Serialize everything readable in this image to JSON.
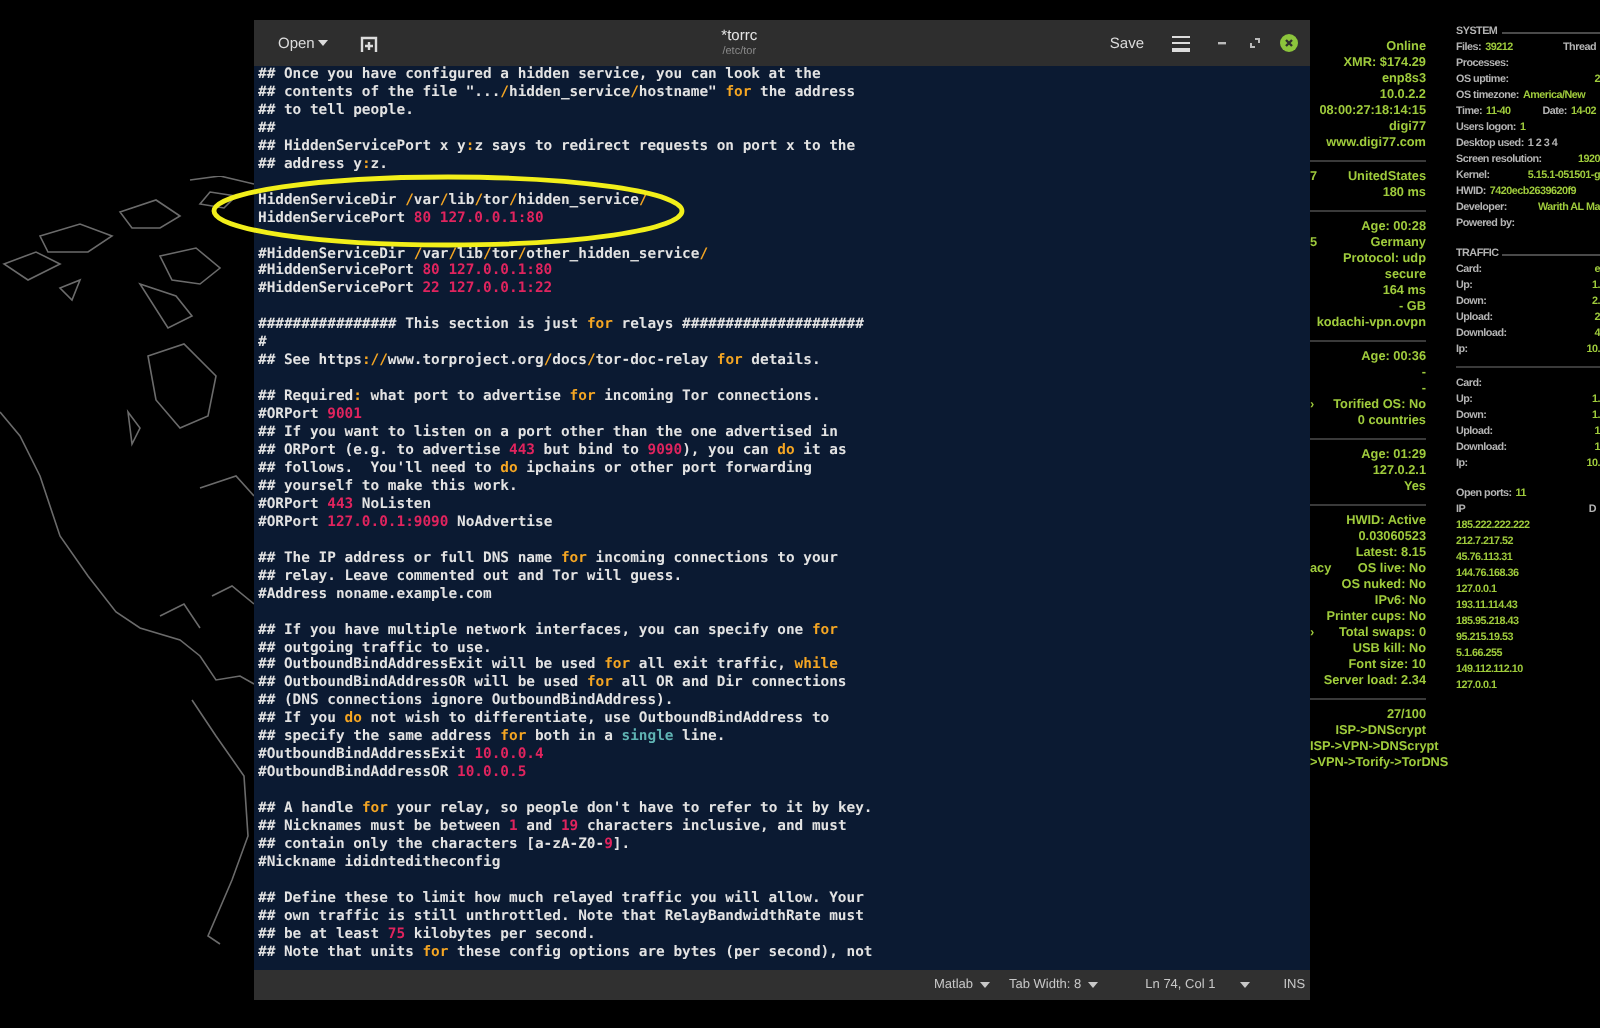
{
  "editor": {
    "open_button": "Open",
    "title": "*torrc",
    "subtitle": "/etc/tor",
    "save_button": "Save",
    "lines": [
      {
        "kind": "code",
        "segments": [
          {
            "kind": "plain",
            "text": "## Once you have configured a hidden service, you can look at the"
          }
        ]
      },
      {
        "kind": "code",
        "segments": [
          {
            "kind": "plain",
            "text": "## contents of the file \"..."
          },
          {
            "kind": "symbol",
            "text": "/"
          },
          {
            "kind": "plain",
            "text": "hidden_service"
          },
          {
            "kind": "symbol",
            "text": "/"
          },
          {
            "kind": "plain",
            "text": "hostname\" "
          },
          {
            "kind": "keyword",
            "text": "for"
          },
          {
            "kind": "plain",
            "text": " the address"
          }
        ]
      },
      {
        "kind": "code",
        "segments": [
          {
            "kind": "plain",
            "text": "## to tell people."
          }
        ]
      },
      {
        "kind": "code",
        "segments": [
          {
            "kind": "plain",
            "text": "##"
          }
        ]
      },
      {
        "kind": "code",
        "segments": [
          {
            "kind": "plain",
            "text": "## HiddenServicePort x y"
          },
          {
            "kind": "symbol",
            "text": ":"
          },
          {
            "kind": "plain",
            "text": "z says to redirect requests on port x to the"
          }
        ]
      },
      {
        "kind": "code",
        "segments": [
          {
            "kind": "plain",
            "text": "## address y"
          },
          {
            "kind": "symbol",
            "text": ":"
          },
          {
            "kind": "plain",
            "text": "z."
          }
        ]
      },
      {
        "kind": "blank"
      },
      {
        "kind": "code",
        "segments": [
          {
            "kind": "plain",
            "text": "HiddenServiceDir "
          },
          {
            "kind": "symbol",
            "text": "/"
          },
          {
            "kind": "plain",
            "text": "var"
          },
          {
            "kind": "symbol",
            "text": "/"
          },
          {
            "kind": "plain",
            "text": "lib"
          },
          {
            "kind": "symbol",
            "text": "/"
          },
          {
            "kind": "plain",
            "text": "tor"
          },
          {
            "kind": "symbol",
            "text": "/"
          },
          {
            "kind": "plain",
            "text": "hidden_service"
          },
          {
            "kind": "symbol",
            "text": "/"
          }
        ]
      },
      {
        "kind": "code",
        "segments": [
          {
            "kind": "plain",
            "text": "HiddenServicePort "
          },
          {
            "kind": "number",
            "text": "80 127.0.0.1:80"
          }
        ]
      },
      {
        "kind": "blank"
      },
      {
        "kind": "code",
        "segments": [
          {
            "kind": "plain",
            "text": "#HiddenServiceDir "
          },
          {
            "kind": "symbol",
            "text": "/"
          },
          {
            "kind": "plain",
            "text": "var"
          },
          {
            "kind": "symbol",
            "text": "/"
          },
          {
            "kind": "plain",
            "text": "lib"
          },
          {
            "kind": "symbol",
            "text": "/"
          },
          {
            "kind": "plain",
            "text": "tor"
          },
          {
            "kind": "symbol",
            "text": "/"
          },
          {
            "kind": "plain",
            "text": "other_hidden_service"
          },
          {
            "kind": "symbol",
            "text": "/"
          }
        ]
      },
      {
        "kind": "code",
        "segments": [
          {
            "kind": "plain",
            "text": "#HiddenServicePort "
          },
          {
            "kind": "number",
            "text": "80 127.0.0.1:80"
          }
        ]
      },
      {
        "kind": "code",
        "segments": [
          {
            "kind": "plain",
            "text": "#HiddenServicePort "
          },
          {
            "kind": "number",
            "text": "22 127.0.0.1:22"
          }
        ]
      },
      {
        "kind": "blank"
      },
      {
        "kind": "code",
        "segments": [
          {
            "kind": "plain",
            "text": "################ This section is just "
          },
          {
            "kind": "keyword",
            "text": "for"
          },
          {
            "kind": "plain",
            "text": " relays #####################"
          }
        ]
      },
      {
        "kind": "code",
        "segments": [
          {
            "kind": "plain",
            "text": "#"
          }
        ]
      },
      {
        "kind": "code",
        "segments": [
          {
            "kind": "plain",
            "text": "## See https"
          },
          {
            "kind": "symbol",
            "text": "://"
          },
          {
            "kind": "plain",
            "text": "www.torproject.org"
          },
          {
            "kind": "symbol",
            "text": "/"
          },
          {
            "kind": "plain",
            "text": "docs"
          },
          {
            "kind": "symbol",
            "text": "/"
          },
          {
            "kind": "plain",
            "text": "tor-doc-relay "
          },
          {
            "kind": "keyword",
            "text": "for"
          },
          {
            "kind": "plain",
            "text": " details."
          }
        ]
      },
      {
        "kind": "blank"
      },
      {
        "kind": "code",
        "segments": [
          {
            "kind": "plain",
            "text": "## Required"
          },
          {
            "kind": "symbol",
            "text": ":"
          },
          {
            "kind": "plain",
            "text": " what port to advertise "
          },
          {
            "kind": "keyword",
            "text": "for"
          },
          {
            "kind": "plain",
            "text": " incoming Tor connections."
          }
        ]
      },
      {
        "kind": "code",
        "segments": [
          {
            "kind": "plain",
            "text": "#ORPort "
          },
          {
            "kind": "number",
            "text": "9001"
          }
        ]
      },
      {
        "kind": "code",
        "segments": [
          {
            "kind": "plain",
            "text": "## If you want to listen on a port other than the one advertised in"
          }
        ]
      },
      {
        "kind": "code",
        "segments": [
          {
            "kind": "plain",
            "text": "## ORPort (e.g. to advertise "
          },
          {
            "kind": "number",
            "text": "443"
          },
          {
            "kind": "plain",
            "text": " but bind to "
          },
          {
            "kind": "number",
            "text": "9090"
          },
          {
            "kind": "plain",
            "text": "), you can "
          },
          {
            "kind": "keyword",
            "text": "do"
          },
          {
            "kind": "plain",
            "text": " it as"
          }
        ]
      },
      {
        "kind": "code",
        "segments": [
          {
            "kind": "plain",
            "text": "## follows.  You'll need to "
          },
          {
            "kind": "keyword",
            "text": "do"
          },
          {
            "kind": "plain",
            "text": " ipchains or other port forwarding"
          }
        ]
      },
      {
        "kind": "code",
        "segments": [
          {
            "kind": "plain",
            "text": "## yourself to make this work."
          }
        ]
      },
      {
        "kind": "code",
        "segments": [
          {
            "kind": "plain",
            "text": "#ORPort "
          },
          {
            "kind": "number",
            "text": "443"
          },
          {
            "kind": "plain",
            "text": " NoListen"
          }
        ]
      },
      {
        "kind": "code",
        "segments": [
          {
            "kind": "plain",
            "text": "#ORPort "
          },
          {
            "kind": "number",
            "text": "127.0.0.1:9090"
          },
          {
            "kind": "plain",
            "text": " NoAdvertise"
          }
        ]
      },
      {
        "kind": "blank"
      },
      {
        "kind": "code",
        "segments": [
          {
            "kind": "plain",
            "text": "## The IP address or full DNS name "
          },
          {
            "kind": "keyword",
            "text": "for"
          },
          {
            "kind": "plain",
            "text": " incoming connections to your"
          }
        ]
      },
      {
        "kind": "code",
        "segments": [
          {
            "kind": "plain",
            "text": "## relay. Leave commented out and Tor will guess."
          }
        ]
      },
      {
        "kind": "code",
        "segments": [
          {
            "kind": "plain",
            "text": "#Address noname.example.com"
          }
        ]
      },
      {
        "kind": "blank"
      },
      {
        "kind": "code",
        "segments": [
          {
            "kind": "plain",
            "text": "## If you have multiple network interfaces, you can specify one "
          },
          {
            "kind": "keyword",
            "text": "for"
          }
        ]
      },
      {
        "kind": "code",
        "segments": [
          {
            "kind": "plain",
            "text": "## outgoing traffic to use."
          }
        ]
      },
      {
        "kind": "code",
        "segments": [
          {
            "kind": "plain",
            "text": "## OutboundBindAddressExit will be used "
          },
          {
            "kind": "keyword",
            "text": "for"
          },
          {
            "kind": "plain",
            "text": " all exit traffic, "
          },
          {
            "kind": "keyword",
            "text": "while"
          }
        ]
      },
      {
        "kind": "code",
        "segments": [
          {
            "kind": "plain",
            "text": "## OutboundBindAddressOR will be used "
          },
          {
            "kind": "keyword",
            "text": "for"
          },
          {
            "kind": "plain",
            "text": " all OR and Dir connections"
          }
        ]
      },
      {
        "kind": "code",
        "segments": [
          {
            "kind": "plain",
            "text": "## (DNS connections ignore OutboundBindAddress)."
          }
        ]
      },
      {
        "kind": "code",
        "segments": [
          {
            "kind": "plain",
            "text": "## If you "
          },
          {
            "kind": "keyword",
            "text": "do"
          },
          {
            "kind": "plain",
            "text": " not wish to differentiate, use OutboundBindAddress to"
          }
        ]
      },
      {
        "kind": "code",
        "segments": [
          {
            "kind": "plain",
            "text": "## specify the same address "
          },
          {
            "kind": "keyword",
            "text": "for"
          },
          {
            "kind": "plain",
            "text": " both in a "
          },
          {
            "kind": "type",
            "text": "single"
          },
          {
            "kind": "plain",
            "text": " line."
          }
        ]
      },
      {
        "kind": "code",
        "segments": [
          {
            "kind": "plain",
            "text": "#OutboundBindAddressExit "
          },
          {
            "kind": "number",
            "text": "10.0.0.4"
          }
        ]
      },
      {
        "kind": "code",
        "segments": [
          {
            "kind": "plain",
            "text": "#OutboundBindAddressOR "
          },
          {
            "kind": "number",
            "text": "10.0.0.5"
          }
        ]
      },
      {
        "kind": "blank"
      },
      {
        "kind": "code",
        "segments": [
          {
            "kind": "plain",
            "text": "## A handle "
          },
          {
            "kind": "keyword",
            "text": "for"
          },
          {
            "kind": "plain",
            "text": " your relay, so people don't have to refer to it by key."
          }
        ]
      },
      {
        "kind": "code",
        "segments": [
          {
            "kind": "plain",
            "text": "## Nicknames must be between "
          },
          {
            "kind": "number",
            "text": "1"
          },
          {
            "kind": "plain",
            "text": " and "
          },
          {
            "kind": "number",
            "text": "19"
          },
          {
            "kind": "plain",
            "text": " characters inclusive, and must"
          }
        ]
      },
      {
        "kind": "code",
        "segments": [
          {
            "kind": "plain",
            "text": "## contain only the characters [a-zA-Z0-"
          },
          {
            "kind": "number",
            "text": "9"
          },
          {
            "kind": "plain",
            "text": "]."
          }
        ]
      },
      {
        "kind": "code",
        "segments": [
          {
            "kind": "plain",
            "text": "#Nickname ididnteditheconfig"
          }
        ]
      },
      {
        "kind": "blank"
      },
      {
        "kind": "code",
        "segments": [
          {
            "kind": "plain",
            "text": "## Define these to limit how much relayed traffic you will allow. Your"
          }
        ]
      },
      {
        "kind": "code",
        "segments": [
          {
            "kind": "plain",
            "text": "## own traffic is still unthrottled. Note that RelayBandwidthRate must"
          }
        ]
      },
      {
        "kind": "code",
        "segments": [
          {
            "kind": "plain",
            "text": "## be at least "
          },
          {
            "kind": "number",
            "text": "75"
          },
          {
            "kind": "plain",
            "text": " kilobytes per second."
          }
        ]
      },
      {
        "kind": "code",
        "segments": [
          {
            "kind": "plain",
            "text": "## Note that units "
          },
          {
            "kind": "keyword",
            "text": "for"
          },
          {
            "kind": "plain",
            "text": " these config options are bytes (per second), not"
          }
        ]
      }
    ],
    "status_bar": {
      "language": "Matlab",
      "tab_width": "Tab Width: 8",
      "position": "Ln 74, Col 1",
      "mode": "INS"
    }
  },
  "status_panel": [
    {
      "kind": "row",
      "text": "Online"
    },
    {
      "kind": "row",
      "text": "XMR: $174.29"
    },
    {
      "kind": "row",
      "text": "enp8s3"
    },
    {
      "kind": "row",
      "text": "10.0.2.2"
    },
    {
      "kind": "row",
      "text": "08:00:27:18:14:15"
    },
    {
      "kind": "row",
      "text": "digi77"
    },
    {
      "kind": "row",
      "text": "www.digi77.com"
    },
    {
      "kind": "divider"
    },
    {
      "kind": "row",
      "cut_label": "7",
      "text": "UnitedStates"
    },
    {
      "kind": "row",
      "text": "180 ms"
    },
    {
      "kind": "divider"
    },
    {
      "kind": "row",
      "text": "Age: 00:28"
    },
    {
      "kind": "row",
      "cut_label": "5",
      "text": "Germany"
    },
    {
      "kind": "row",
      "text": "Protocol: udp"
    },
    {
      "kind": "row",
      "text": "secure"
    },
    {
      "kind": "row",
      "text": "164 ms"
    },
    {
      "kind": "row",
      "text": "- GB"
    },
    {
      "kind": "row",
      "text": "kodachi-vpn.ovpn"
    },
    {
      "kind": "divider"
    },
    {
      "kind": "row",
      "text": "Age: 00:36"
    },
    {
      "kind": "row",
      "text": "-"
    },
    {
      "kind": "row",
      "text": "-"
    },
    {
      "kind": "row",
      "cut_label": "›",
      "text": "Torified OS: No"
    },
    {
      "kind": "row",
      "text": "0 countries"
    },
    {
      "kind": "divider"
    },
    {
      "kind": "row",
      "text": "Age: 01:29"
    },
    {
      "kind": "row",
      "text": "127.0.2.1"
    },
    {
      "kind": "row",
      "text": "Yes"
    },
    {
      "kind": "divider"
    },
    {
      "kind": "row",
      "text": "HWID: Active"
    },
    {
      "kind": "row",
      "text": "0.03060523"
    },
    {
      "kind": "row",
      "text": "Latest: 8.15"
    },
    {
      "kind": "row",
      "cut_label": "acy",
      "text": "OS live: No"
    },
    {
      "kind": "row",
      "text": "OS nuked: No"
    },
    {
      "kind": "row",
      "text": "IPv6: No"
    },
    {
      "kind": "row",
      "text": "Printer cups: No"
    },
    {
      "kind": "row",
      "cut_label": "›",
      "text": "Total swaps: 0"
    },
    {
      "kind": "row",
      "text": "USB kill: No"
    },
    {
      "kind": "row",
      "text": "Font size: 10"
    },
    {
      "kind": "row",
      "text": "Server load: 2.34"
    },
    {
      "kind": "divider"
    },
    {
      "kind": "row",
      "text": "27/100"
    },
    {
      "kind": "row",
      "text": "ISP->DNScrypt"
    },
    {
      "kind": "row",
      "text": "ISP->VPN->DNScrypt"
    },
    {
      "kind": "row",
      "text": ">VPN->Torify->TorDNS"
    }
  ],
  "system_panel": [
    {
      "kind": "header",
      "text": "SYSTEM"
    },
    {
      "kind": "row",
      "cells": [
        {
          "kind": "label",
          "text": "Files:"
        },
        {
          "kind": "value",
          "text": "39212"
        },
        {
          "kind": "far_label",
          "text": "Thread"
        }
      ]
    },
    {
      "kind": "row",
      "cells": [
        {
          "kind": "label",
          "text": "Processes:"
        }
      ]
    },
    {
      "kind": "row",
      "cells": [
        {
          "kind": "label",
          "text": "OS uptime:"
        },
        {
          "kind": "far_value",
          "text": "2"
        }
      ]
    },
    {
      "kind": "row",
      "cells": [
        {
          "kind": "label",
          "text": "OS timezone:"
        },
        {
          "kind": "value",
          "text": "America/New"
        }
      ]
    },
    {
      "kind": "row",
      "cells": [
        {
          "kind": "label",
          "text": "Time:"
        },
        {
          "kind": "value",
          "text": "11-40"
        },
        {
          "kind": "far_label",
          "text": "Date:"
        },
        {
          "kind": "value",
          "text": "14-02"
        }
      ]
    },
    {
      "kind": "row",
      "cells": [
        {
          "kind": "label",
          "text": "Users logon:"
        },
        {
          "kind": "value",
          "text": "1"
        }
      ]
    },
    {
      "kind": "row",
      "cells": [
        {
          "kind": "label",
          "text": "Desktop used:"
        },
        {
          "kind": "label",
          "text": "1 2 3 4"
        }
      ]
    },
    {
      "kind": "row",
      "cells": [
        {
          "kind": "label",
          "text": "Screen resolution:"
        },
        {
          "kind": "far_value",
          "text": "1920"
        }
      ]
    },
    {
      "kind": "row",
      "cells": [
        {
          "kind": "label",
          "text": "Kernel:"
        },
        {
          "kind": "far_value",
          "text": "5.15.1-051501-g"
        }
      ]
    },
    {
      "kind": "row",
      "cells": [
        {
          "kind": "label",
          "text": "HWID:"
        },
        {
          "kind": "value",
          "text": "7420ecb2639620f9"
        }
      ]
    },
    {
      "kind": "row",
      "cells": [
        {
          "kind": "label",
          "text": "Developer:"
        },
        {
          "kind": "far_value",
          "text": "Warith AL Ma"
        }
      ]
    },
    {
      "kind": "row",
      "cells": [
        {
          "kind": "label",
          "text": "Powered by:"
        }
      ]
    },
    {
      "kind": "gap"
    },
    {
      "kind": "header",
      "text": "TRAFFIC"
    },
    {
      "kind": "row",
      "cells": [
        {
          "kind": "label",
          "text": "Card:"
        },
        {
          "kind": "far_value",
          "text": "e"
        }
      ]
    },
    {
      "kind": "row",
      "cells": [
        {
          "kind": "label",
          "text": "Up:"
        },
        {
          "kind": "far_value",
          "text": "1."
        }
      ]
    },
    {
      "kind": "row",
      "cells": [
        {
          "kind": "label",
          "text": "Down:"
        },
        {
          "kind": "far_value",
          "text": "2."
        }
      ]
    },
    {
      "kind": "row",
      "cells": [
        {
          "kind": "label",
          "text": "Upload:"
        },
        {
          "kind": "far_value",
          "text": "2"
        }
      ]
    },
    {
      "kind": "row",
      "cells": [
        {
          "kind": "label",
          "text": "Download:"
        },
        {
          "kind": "far_value",
          "text": "4"
        }
      ]
    },
    {
      "kind": "row",
      "cells": [
        {
          "kind": "label",
          "text": "Ip:"
        },
        {
          "kind": "far_value",
          "text": "10."
        }
      ]
    },
    {
      "kind": "divider"
    },
    {
      "kind": "row",
      "cells": [
        {
          "kind": "label",
          "text": "Card:"
        }
      ]
    },
    {
      "kind": "row",
      "cells": [
        {
          "kind": "label",
          "text": "Up:"
        },
        {
          "kind": "far_value",
          "text": "1."
        }
      ]
    },
    {
      "kind": "row",
      "cells": [
        {
          "kind": "label",
          "text": "Down:"
        },
        {
          "kind": "far_value",
          "text": "1."
        }
      ]
    },
    {
      "kind": "row",
      "cells": [
        {
          "kind": "label",
          "text": "Upload:"
        },
        {
          "kind": "far_value",
          "text": "1"
        }
      ]
    },
    {
      "kind": "row",
      "cells": [
        {
          "kind": "label",
          "text": "Download:"
        },
        {
          "kind": "far_value",
          "text": "1"
        }
      ]
    },
    {
      "kind": "row",
      "cells": [
        {
          "kind": "label",
          "text": "Ip:"
        },
        {
          "kind": "far_value",
          "text": "10."
        }
      ]
    },
    {
      "kind": "gap"
    },
    {
      "kind": "row",
      "cells": [
        {
          "kind": "label",
          "text": "Open ports:"
        },
        {
          "kind": "value",
          "text": "11"
        }
      ]
    },
    {
      "kind": "row",
      "cells": [
        {
          "kind": "label",
          "text": "IP"
        },
        {
          "kind": "far_label",
          "text": "D"
        }
      ]
    },
    {
      "kind": "row",
      "cells": [
        {
          "kind": "value",
          "text": "185.222.222.222"
        }
      ]
    },
    {
      "kind": "row",
      "cells": [
        {
          "kind": "value",
          "text": "212.7.217.52"
        }
      ]
    },
    {
      "kind": "row",
      "cells": [
        {
          "kind": "value",
          "text": "45.76.113.31"
        }
      ]
    },
    {
      "kind": "row",
      "cells": [
        {
          "kind": "value",
          "text": "144.76.168.36"
        }
      ]
    },
    {
      "kind": "row",
      "cells": [
        {
          "kind": "value",
          "text": "127.0.0.1"
        }
      ]
    },
    {
      "kind": "row",
      "cells": [
        {
          "kind": "value",
          "text": "193.11.114.43"
        }
      ]
    },
    {
      "kind": "row",
      "cells": [
        {
          "kind": "value",
          "text": "185.95.218.43"
        }
      ]
    },
    {
      "kind": "row",
      "cells": [
        {
          "kind": "value",
          "text": "95.215.19.53"
        }
      ]
    },
    {
      "kind": "row",
      "cells": [
        {
          "kind": "value",
          "text": "5.1.66.255"
        }
      ]
    },
    {
      "kind": "row",
      "cells": [
        {
          "kind": "value",
          "text": "149.112.112.10"
        }
      ]
    },
    {
      "kind": "row",
      "cells": [
        {
          "kind": "value",
          "text": "127.0.0.1"
        }
      ]
    }
  ]
}
